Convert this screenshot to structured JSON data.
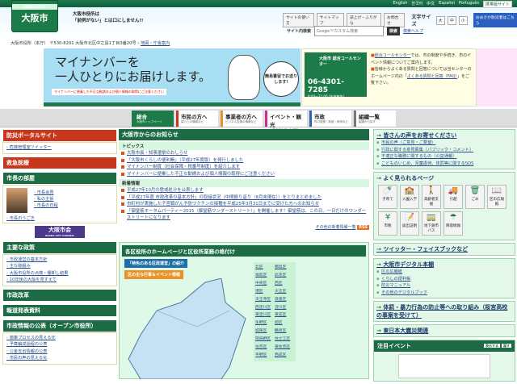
{
  "header": {
    "logo_sub": "OSAKA CITY",
    "logo_main": "大阪市",
    "tagline1": "大阪市役所は",
    "tagline2": "「前例がない」とは口にしません!!",
    "languages": [
      "English",
      "한국어",
      "中文",
      "Español",
      "Português"
    ],
    "mobile_site": "携帯版サイト",
    "util": [
      "サイトの使い方",
      "サイトマップ",
      "読上げ・ふりがな",
      "お問合せ"
    ],
    "font_size_label": "文字サイズ",
    "font_sizes": [
      "大",
      "中",
      "小"
    ],
    "osaka_app": "おおさか防災者はこちら",
    "search_label": "サイト内検索",
    "search_placeholder": "Google™カスタム検索",
    "search_button": "検索",
    "search_help": "検索ヘルプ",
    "address": "大阪市役所（本庁） 〒530-8201 大阪市北区中之島1丁目3番20号",
    "map_link": "地図・庁舎案内"
  },
  "banner": {
    "line1": "マイナンバーを",
    "line2": "一人ひとりにお届けします。",
    "bubble": "簡易書留でお送りします!",
    "warning": "マイナンバーに便乗した不正な勧誘および個人情報の取得にご注意ください"
  },
  "call": {
    "label": "大阪市 総合コールセンター",
    "nick": "なにわコール",
    "phone": "06-4301-7285",
    "hours": "8:00～21:00 (年中無休)",
    "text1_link": "総合コールセンター",
    "text1": "では、市の制度や手続き、市のイベント情報についてご案内します。",
    "text2": "皆様からよくある質問と回答については当センターのホームページ内の「",
    "text2_link": "よくある質問と回答（FAQ）",
    "text2_end": "」をご覧下さい。"
  },
  "nav": [
    {
      "title": "総合",
      "sub": "大阪市トップページ",
      "color": "#1c7b49"
    },
    {
      "title": "市民の方へ",
      "sub": "暮らしの情報など",
      "color": "#c8361b"
    },
    {
      "title": "事業者の方へ",
      "sub": "ビジネス支援の情報など",
      "color": "#e8932a"
    },
    {
      "title": "イベント・観光",
      "sub": "大阪市内で楽しむ情報",
      "color": "#d02c8e"
    },
    {
      "title": "市政",
      "sub": "市の施策・財政・条例など",
      "color": "#2b66b2"
    },
    {
      "title": "組織一覧",
      "sub": "組織から探す",
      "color": "#777"
    }
  ],
  "left": {
    "bousai": "防災ポータルサイト",
    "bousai_items": [
      "危機管理室ツイッター"
    ],
    "kyukyu": "救急医療",
    "mayor": "市長の部屋",
    "mayor_items": [
      "市長会見",
      "私の主張",
      "市長の日程"
    ],
    "mayor_move": "市長のうごき",
    "council": "大阪市会",
    "council_sub": "OSAKA CITY COUNCIL",
    "policy": "主要な政策",
    "policy_items": [
      "市政運営の基本方針",
      "主な取組み",
      "大阪市役所の点検・棚卸し結果",
      "10年後の大阪を見すえて"
    ],
    "reform": "市政改革",
    "press": "報道発表資料",
    "open": "市政情報の公表（オープン市役所）",
    "open_items": [
      "施策プロセスの見える化",
      "予算編成過程の公表",
      "公金支出情報の公表",
      "市民の声の見える化"
    ]
  },
  "center": {
    "title": "大阪市からのお知らせ",
    "topics": "トピックス",
    "topic_items": [
      "大阪市長・知事選挙のおしらせ",
      "「大阪市くらしの便利帳」（平成27年度版）を発行しました",
      "マイナンバー制度（社会保障・税番号制度）を紹介します",
      "マイナンバーに便乗した不正な勧誘および個人情報の取得にご注意ください"
    ],
    "news": "新着情報",
    "news_items": [
      "平成27年10月の懲戒処分を公表します",
      "「平成27年度 市政改革の基本方針」の取組状況（中間振り返り（8月末現在））をとりまとめました",
      "市町村が実施した子宮頸がん予防ワクチンの接種を平成25年3月31日までに受けた方へのお知らせ",
      "「御堂筋オータムパーティー2015（御堂筋ワンダーストリート）」を開催します！御堂筋は、この日、一日だけのワンダーストリートになります"
    ],
    "more": "その他の新着情報一覧",
    "rss": "RSS",
    "map_title": "各区役所のホームページと区役所業務の格付け",
    "map_btn1": "「特色のある区政運営」の紹介",
    "map_btn2": "区の主な行事＆イベント情報",
    "wards": [
      "北区",
      "都島区",
      "福島区",
      "此花区",
      "中央区",
      "西区",
      "港区",
      "大正区",
      "天王寺区",
      "浪速区",
      "西淀川区",
      "淀川区",
      "東淀川区",
      "東成区",
      "生野区",
      "旭区",
      "城東区",
      "鶴見区",
      "阿倍野区",
      "住之江区",
      "住吉区",
      "東住吉区",
      "平野区",
      "西成区"
    ]
  },
  "right": {
    "voice": "皆さんの声をお寄せください",
    "voice_items": [
      "市民の声（ご意見・ご要望）",
      "行政に関する意見募集（パブリック・コメント）",
      "不適正な職務に関するもの（公益通報）",
      "こどものいじめ、児童虐待、体罰等に関するSOS"
    ],
    "popular": "よく見られるページ",
    "icons": [
      {
        "label": "子育て",
        "glyph": "🍼"
      },
      {
        "label": "入園入学",
        "glyph": "🏫"
      },
      {
        "label": "高齢者支援",
        "glyph": "🚶"
      },
      {
        "label": "引越",
        "glyph": "🚚"
      },
      {
        "label": "ごみ",
        "glyph": "🗑"
      },
      {
        "label": "区の広報紙",
        "glyph": "📖"
      },
      {
        "label": "市税",
        "glyph": "¥"
      },
      {
        "label": "届出証明",
        "glyph": "📝"
      },
      {
        "label": "地下鉄市バス",
        "glyph": "🚃"
      },
      {
        "label": "降雨情報",
        "glyph": "☂"
      }
    ],
    "sns": "ツイッター・フェイスブックなど",
    "digital": "大阪市デジタル本棚",
    "digital_items": [
      "区の広報紙",
      "くらしの便利帳",
      "防災マニュアル",
      "その他のデジタルブック"
    ],
    "taibatsu": "体罰・暴力行為の防止等への取り組み（桜宮高校の事案を受けて）",
    "shinsai": "東日本大震災関連",
    "event": "注目イベント",
    "show": "表示する",
    "hide": "隠す"
  }
}
